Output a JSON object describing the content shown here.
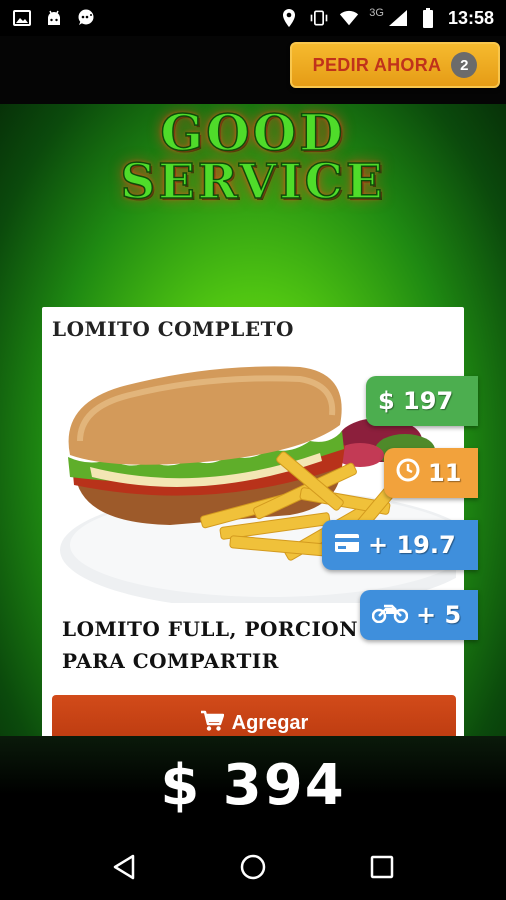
{
  "status_bar": {
    "time": "13:58",
    "network": "3G",
    "icons": [
      "image-icon",
      "android-icon",
      "chat-icon",
      "location-icon",
      "vibrate-icon",
      "wifi-icon",
      "signal-icon",
      "battery-icon"
    ]
  },
  "header": {
    "order_button_label": "PEDIR AHORA",
    "order_count": "2"
  },
  "logo": {
    "line1": "GOOD",
    "line2": "SERVICE"
  },
  "product": {
    "title": "LOMITO COMPLETO",
    "description_line1": "LOMITO FULL, PORCION",
    "description_line2": "PARA COMPARTIR",
    "add_button_label": "Agregar",
    "price": "$ 197",
    "prep_time": "11",
    "card_surcharge": "+ 19.7",
    "delivery_cost": "+ 5"
  },
  "total": {
    "amount": "$ 394"
  },
  "colors": {
    "accent_orange": "#f6ba2e",
    "add_button": "#c4401a",
    "price_badge": "#4cae4f",
    "time_badge": "#f2a23c",
    "info_badge": "#3f8fdc",
    "background_green": "#4fc412"
  }
}
